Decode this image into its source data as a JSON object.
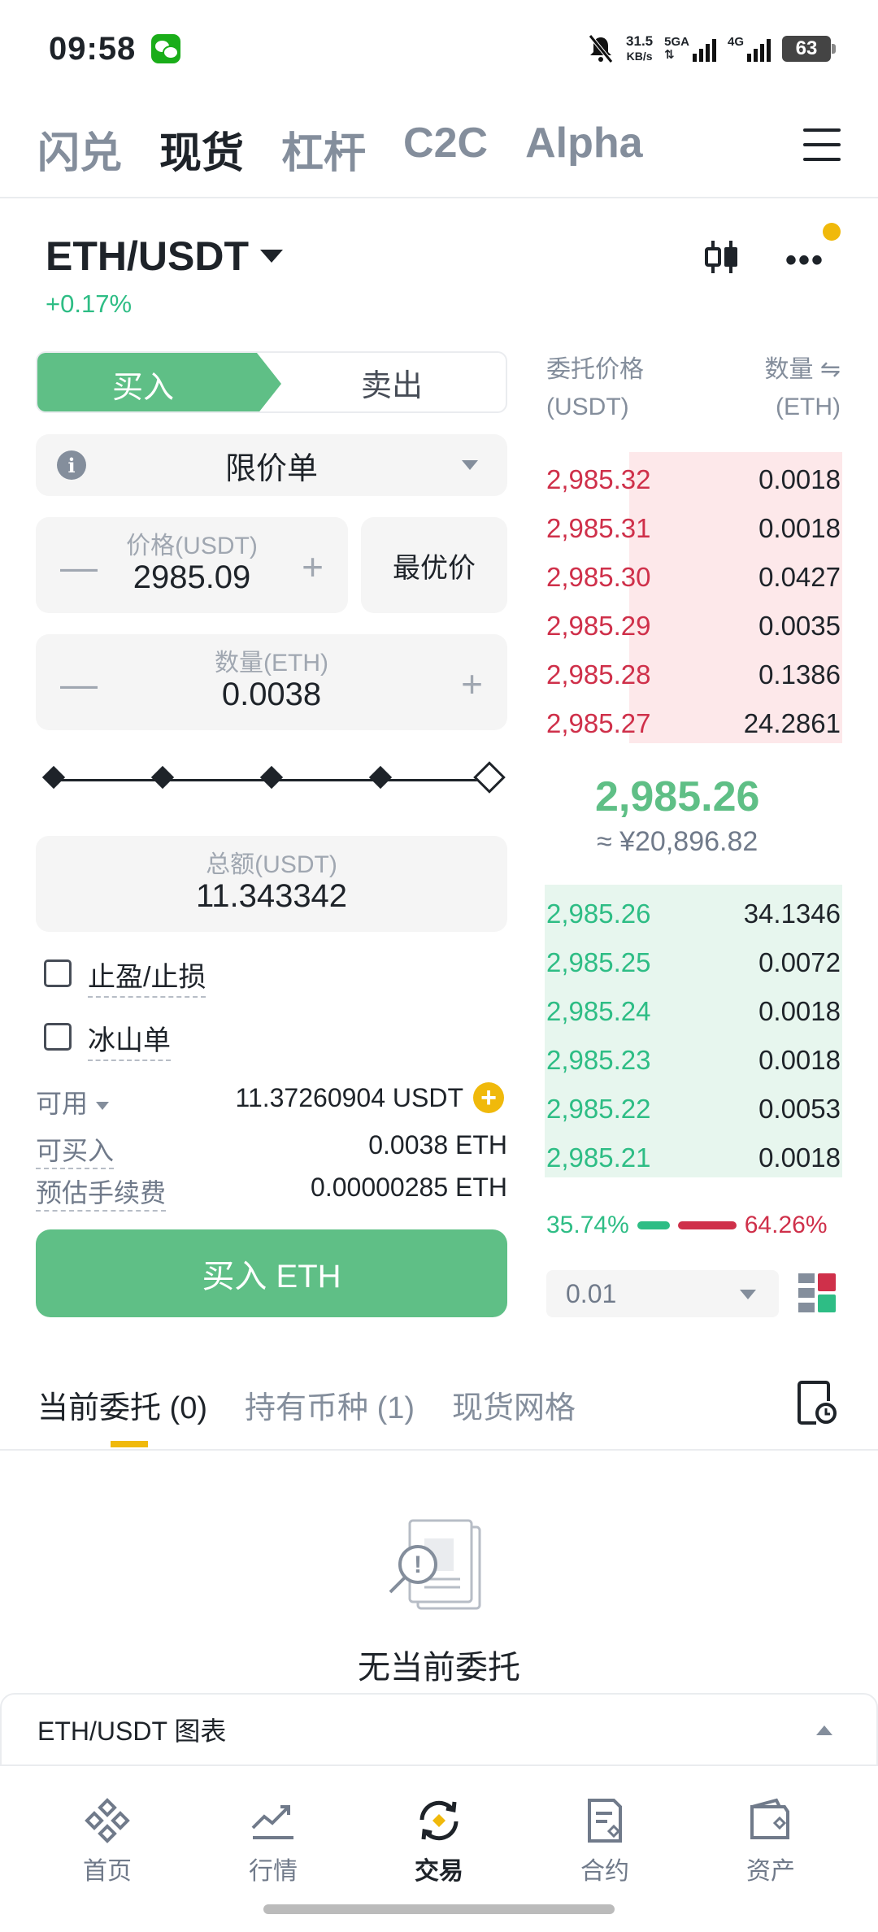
{
  "status": {
    "time": "09:58",
    "speed_top": "31.5",
    "speed_bottom": "KB/s",
    "net1": "5GA",
    "net2": "4G",
    "battery": "63"
  },
  "top_tabs": [
    "闪兑",
    "现货",
    "杠杆",
    "C2C",
    "Alpha"
  ],
  "pair": {
    "symbol": "ETH/USDT",
    "change": "+0.17%"
  },
  "trade": {
    "buy_label": "买入",
    "sell_label": "卖出",
    "order_type": "限价单",
    "price_label": "价格(USDT)",
    "price_value": "2985.09",
    "best_price": "最优价",
    "qty_label": "数量(ETH)",
    "qty_value": "0.0038",
    "slider_percent": 100,
    "total_label": "总额(USDT)",
    "total_value": "11.343342",
    "tpsl": "止盈/止损",
    "iceberg": "冰山单",
    "available_label": "可用",
    "available_value": "11.37260904 USDT",
    "max_buy_label": "可买入",
    "max_buy_value": "0.0038 ETH",
    "fee_label": "预估手续费",
    "fee_value": "0.00000285 ETH",
    "buy_button": "买入 ETH"
  },
  "orderbook": {
    "price_header": "委托价格",
    "price_unit": "(USDT)",
    "qty_header": "数量 ⇋",
    "qty_unit": "(ETH)",
    "asks": [
      {
        "price": "2,985.32",
        "qty": "0.0018"
      },
      {
        "price": "2,985.31",
        "qty": "0.0018"
      },
      {
        "price": "2,985.30",
        "qty": "0.0427"
      },
      {
        "price": "2,985.29",
        "qty": "0.0035"
      },
      {
        "price": "2,985.28",
        "qty": "0.1386"
      },
      {
        "price": "2,985.27",
        "qty": "24.2861"
      }
    ],
    "mid_price": "2,985.26",
    "mid_cny": "≈ ¥20,896.82",
    "bids": [
      {
        "price": "2,985.26",
        "qty": "34.1346"
      },
      {
        "price": "2,985.25",
        "qty": "0.0072"
      },
      {
        "price": "2,985.24",
        "qty": "0.0018"
      },
      {
        "price": "2,985.23",
        "qty": "0.0018"
      },
      {
        "price": "2,985.22",
        "qty": "0.0053"
      },
      {
        "price": "2,985.21",
        "qty": "0.0018"
      }
    ],
    "buy_ratio": "35.74%",
    "sell_ratio": "64.26%",
    "precision": "0.01"
  },
  "bottom_tabs": [
    "当前委托 (0)",
    "持有币种 (1)",
    "现货网格"
  ],
  "empty_text": "无当前委托",
  "chart_bar": "ETH/USDT 图表",
  "nav": [
    "首页",
    "行情",
    "交易",
    "合约",
    "资产"
  ],
  "colors": {
    "buy": "#5fbf86",
    "ask": "#cf304a",
    "bid": "#2ebd85",
    "accent": "#f0b90b"
  }
}
